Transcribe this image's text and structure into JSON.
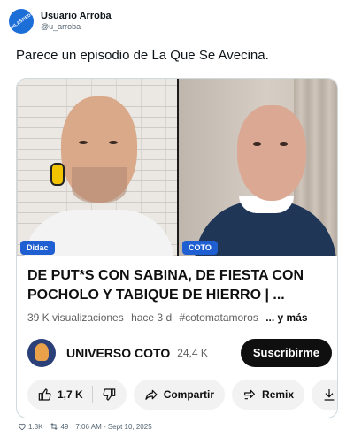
{
  "tweet": {
    "avatar_watermark": "VISTOENLASREDES.com",
    "display_name": "Usuario Arroba",
    "handle": "@u_arroba",
    "text": "Parece un episodio de La Que Se Avecina.",
    "likes": "1.3K",
    "retweets": "49",
    "timestamp": "7:06 AM - Sept 10, 2025"
  },
  "video": {
    "left_name_tag": "Didac",
    "right_name_tag": "COTO",
    "title": "DE PUT*S CON SABINA, DE FIESTA CON POCHOLO Y TABIQUE DE HIERRO | ...",
    "views": "39 K visualizaciones",
    "age": "hace 3 d",
    "hashtag": "#cotomatamoros",
    "more": "... y más"
  },
  "channel": {
    "name": "UNIVERSO COTO",
    "subscribers": "24,4 K",
    "subscribe_label": "Suscribirme"
  },
  "actions": {
    "like_count": "1,7 K",
    "share_label": "Compartir",
    "remix_label": "Remix",
    "download_label": "De"
  },
  "colors": {
    "name_tag": "#1f5fd1",
    "subscribe_bg": "#0f0f0f",
    "pill_bg": "#f2f2f2"
  }
}
